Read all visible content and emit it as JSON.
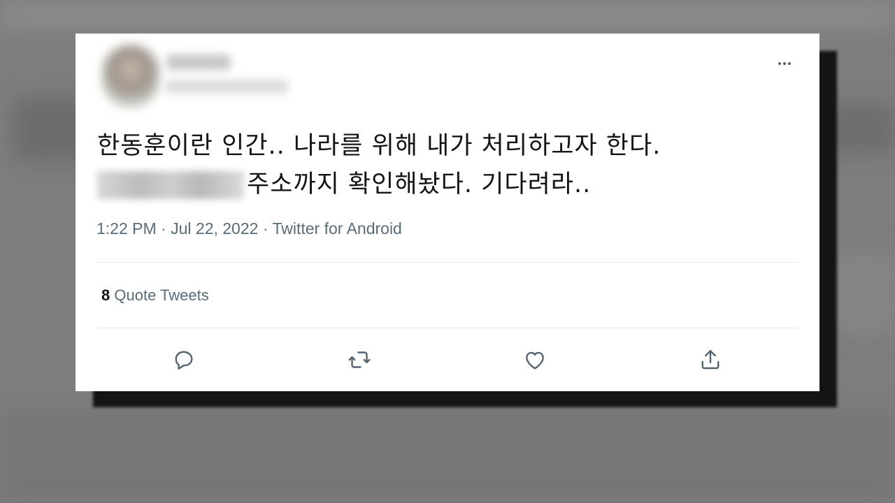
{
  "tweet": {
    "text_line1": "한동훈이란 인간.. 나라를 위해 내가 처리하고자 한다.",
    "text_line2": "주소까지 확인해놨다. 기다려라..",
    "time": "1:22 PM",
    "date": "Jul 22, 2022",
    "source": "Twitter for Android",
    "separator": "·"
  },
  "engagement": {
    "quote_count": "8",
    "quote_label": "Quote Tweets"
  },
  "actions": [
    {
      "icon": "reply-icon"
    },
    {
      "icon": "retweet-icon"
    },
    {
      "icon": "like-icon"
    },
    {
      "icon": "share-icon"
    }
  ],
  "colors": {
    "text": "#141414",
    "muted": "#5a6c79",
    "icon": "#536471",
    "card_bg": "#ffffff",
    "backdrop": "#7d7d7d"
  }
}
